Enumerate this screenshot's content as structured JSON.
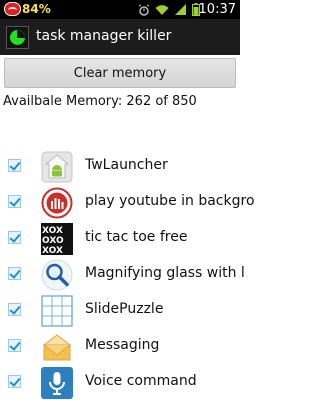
{
  "status_bar": {
    "battery_percent": "84%",
    "time": "10:37"
  },
  "title_bar": {
    "app_title": "task manager killer"
  },
  "actions": {
    "clear_memory_label": "Clear memory"
  },
  "memory": {
    "text": "Availbale Memory: 262 of 850"
  },
  "apps": [
    {
      "name": "TwLauncher",
      "checked": true,
      "icon": "android-launcher-icon"
    },
    {
      "name": "play youtube in backgro",
      "checked": true,
      "icon": "youtube-audio-icon"
    },
    {
      "name": "tic tac toe free",
      "checked": true,
      "icon": "tic-tac-toe-icon"
    },
    {
      "name": "Magnifying glass with l",
      "checked": true,
      "icon": "magnifying-glass-icon"
    },
    {
      "name": "SlidePuzzle",
      "checked": true,
      "icon": "slide-puzzle-icon"
    },
    {
      "name": "Messaging",
      "checked": true,
      "icon": "messaging-envelope-icon"
    },
    {
      "name": "Voice command",
      "checked": true,
      "icon": "microphone-icon"
    }
  ]
}
